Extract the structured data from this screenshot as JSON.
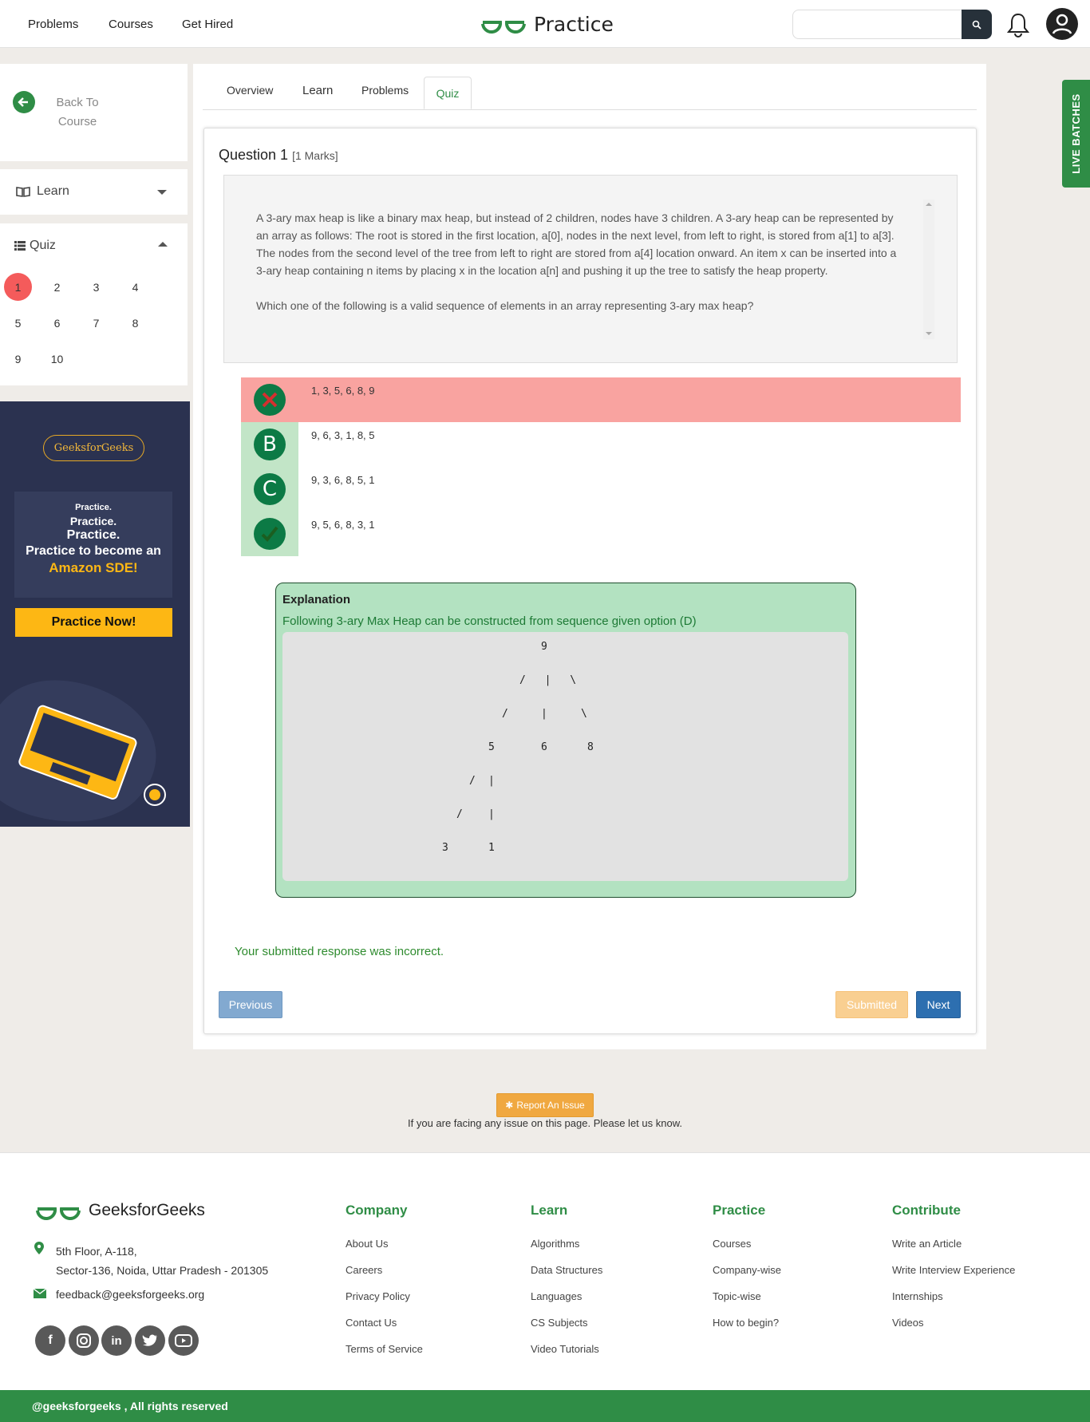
{
  "header": {
    "nav": [
      "Problems",
      "Courses",
      "Get Hired"
    ],
    "brand": "Practice",
    "search_placeholder": "",
    "brand_color": "#2f8d46"
  },
  "sidebar": {
    "back_label": "Back To Course",
    "learn_label": "Learn",
    "quiz_label": "Quiz",
    "question_numbers": [
      "1",
      "2",
      "3",
      "4",
      "5",
      "6",
      "7",
      "8",
      "9",
      "10"
    ],
    "active_question": "1"
  },
  "ad": {
    "brand": "GeeksforGeeks",
    "line1": "Practice.",
    "line2": "Practice.",
    "line3": "Practice.",
    "line4": "Practice to become an",
    "line5": "Amazon SDE!",
    "cta": "Practice Now!"
  },
  "tabs": [
    "Overview",
    "Learn",
    "Problems",
    "Quiz"
  ],
  "question": {
    "title": "Question 1",
    "marks": "[1 Marks]",
    "body": "A 3-ary max heap is like a binary max heap, but instead of 2 children, nodes have 3 children. A 3-ary heap can be represented by an array as follows: The root is stored in the first location, a[0], nodes in the next level, from left to right, is stored from a[1] to a[3]. The nodes from the second level of the tree from left to right are stored from a[4] location onward. An item x can be inserted into a 3-ary heap containing n items by placing x in the location a[n] and pushing it up the tree to satisfy the heap property.",
    "prompt": "Which one of the following is a valid sequence of elements in an array representing 3-ary max heap?"
  },
  "options": [
    {
      "icon": "wrong",
      "text": "1, 3, 5, 6, 8, 9"
    },
    {
      "icon": "B",
      "text": "9, 6, 3, 1, 8, 5"
    },
    {
      "icon": "C",
      "text": "9, 3, 6, 8, 5, 1"
    },
    {
      "icon": "correct",
      "text": "9, 5, 6, 8, 3, 1"
    }
  ],
  "explanation": {
    "title": "Explanation",
    "subtitle": "Following 3-ary Max Heap can be constructed from sequence given option (D)",
    "tree": {
      "root": "9",
      "level1": [
        "5",
        "6",
        "8"
      ],
      "level2": [
        "3",
        "1"
      ]
    }
  },
  "result_message": "Your submitted response was incorrect.",
  "buttons": {
    "previous": "Previous",
    "submitted": "Submitted",
    "next": "Next"
  },
  "report": {
    "label": "Report An Issue",
    "note": "If you are facing any issue on this page. Please let us know."
  },
  "live_batches": "LIVE BATCHES",
  "footer": {
    "brand": "GeeksforGeeks",
    "address_line1": "5th Floor, A-118,",
    "address_line2": "Sector-136, Noida, Uttar Pradesh - 201305",
    "email": "feedback@geeksforgeeks.org",
    "columns": [
      {
        "title": "Company",
        "links": [
          "About Us",
          "Careers",
          "Privacy Policy",
          "Contact Us",
          "Terms of Service"
        ]
      },
      {
        "title": "Learn",
        "links": [
          "Algorithms",
          "Data Structures",
          "Languages",
          "CS Subjects",
          "Video Tutorials"
        ]
      },
      {
        "title": "Practice",
        "links": [
          "Courses",
          "Company-wise",
          "Topic-wise",
          "How to begin?"
        ]
      },
      {
        "title": "Contribute",
        "links": [
          "Write an Article",
          "Write Interview Experience",
          "Internships",
          "Videos"
        ]
      }
    ],
    "social": [
      "facebook-icon",
      "instagram-icon",
      "linkedin-icon",
      "twitter-icon",
      "youtube-icon"
    ],
    "copyright": "@geeksforgeeks , All rights reserved"
  }
}
